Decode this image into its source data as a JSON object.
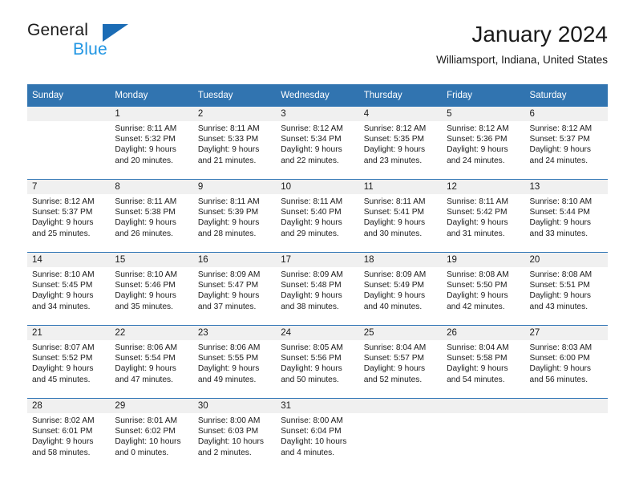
{
  "brand": {
    "name_top": "General",
    "name_bottom": "Blue",
    "triangle_icon": "triangle-icon",
    "accent_blue": "#1b6cb5",
    "light_blue": "#2196e3"
  },
  "header": {
    "title": "January 2024",
    "location": "Williamsport, Indiana, United States"
  },
  "theme": {
    "header_blue": "#3174b0",
    "row_rule_blue": "#2e74b5",
    "daynum_band": "#f0f0f0"
  },
  "columns": [
    "Sunday",
    "Monday",
    "Tuesday",
    "Wednesday",
    "Thursday",
    "Friday",
    "Saturday"
  ],
  "weeks": [
    [
      {
        "day": ""
      },
      {
        "day": "1",
        "sunrise": "Sunrise: 8:11 AM",
        "sunset": "Sunset: 5:32 PM",
        "daylight_1": "Daylight: 9 hours",
        "daylight_2": "and 20 minutes."
      },
      {
        "day": "2",
        "sunrise": "Sunrise: 8:11 AM",
        "sunset": "Sunset: 5:33 PM",
        "daylight_1": "Daylight: 9 hours",
        "daylight_2": "and 21 minutes."
      },
      {
        "day": "3",
        "sunrise": "Sunrise: 8:12 AM",
        "sunset": "Sunset: 5:34 PM",
        "daylight_1": "Daylight: 9 hours",
        "daylight_2": "and 22 minutes."
      },
      {
        "day": "4",
        "sunrise": "Sunrise: 8:12 AM",
        "sunset": "Sunset: 5:35 PM",
        "daylight_1": "Daylight: 9 hours",
        "daylight_2": "and 23 minutes."
      },
      {
        "day": "5",
        "sunrise": "Sunrise: 8:12 AM",
        "sunset": "Sunset: 5:36 PM",
        "daylight_1": "Daylight: 9 hours",
        "daylight_2": "and 24 minutes."
      },
      {
        "day": "6",
        "sunrise": "Sunrise: 8:12 AM",
        "sunset": "Sunset: 5:37 PM",
        "daylight_1": "Daylight: 9 hours",
        "daylight_2": "and 24 minutes."
      }
    ],
    [
      {
        "day": "7",
        "sunrise": "Sunrise: 8:12 AM",
        "sunset": "Sunset: 5:37 PM",
        "daylight_1": "Daylight: 9 hours",
        "daylight_2": "and 25 minutes."
      },
      {
        "day": "8",
        "sunrise": "Sunrise: 8:11 AM",
        "sunset": "Sunset: 5:38 PM",
        "daylight_1": "Daylight: 9 hours",
        "daylight_2": "and 26 minutes."
      },
      {
        "day": "9",
        "sunrise": "Sunrise: 8:11 AM",
        "sunset": "Sunset: 5:39 PM",
        "daylight_1": "Daylight: 9 hours",
        "daylight_2": "and 28 minutes."
      },
      {
        "day": "10",
        "sunrise": "Sunrise: 8:11 AM",
        "sunset": "Sunset: 5:40 PM",
        "daylight_1": "Daylight: 9 hours",
        "daylight_2": "and 29 minutes."
      },
      {
        "day": "11",
        "sunrise": "Sunrise: 8:11 AM",
        "sunset": "Sunset: 5:41 PM",
        "daylight_1": "Daylight: 9 hours",
        "daylight_2": "and 30 minutes."
      },
      {
        "day": "12",
        "sunrise": "Sunrise: 8:11 AM",
        "sunset": "Sunset: 5:42 PM",
        "daylight_1": "Daylight: 9 hours",
        "daylight_2": "and 31 minutes."
      },
      {
        "day": "13",
        "sunrise": "Sunrise: 8:10 AM",
        "sunset": "Sunset: 5:44 PM",
        "daylight_1": "Daylight: 9 hours",
        "daylight_2": "and 33 minutes."
      }
    ],
    [
      {
        "day": "14",
        "sunrise": "Sunrise: 8:10 AM",
        "sunset": "Sunset: 5:45 PM",
        "daylight_1": "Daylight: 9 hours",
        "daylight_2": "and 34 minutes."
      },
      {
        "day": "15",
        "sunrise": "Sunrise: 8:10 AM",
        "sunset": "Sunset: 5:46 PM",
        "daylight_1": "Daylight: 9 hours",
        "daylight_2": "and 35 minutes."
      },
      {
        "day": "16",
        "sunrise": "Sunrise: 8:09 AM",
        "sunset": "Sunset: 5:47 PM",
        "daylight_1": "Daylight: 9 hours",
        "daylight_2": "and 37 minutes."
      },
      {
        "day": "17",
        "sunrise": "Sunrise: 8:09 AM",
        "sunset": "Sunset: 5:48 PM",
        "daylight_1": "Daylight: 9 hours",
        "daylight_2": "and 38 minutes."
      },
      {
        "day": "18",
        "sunrise": "Sunrise: 8:09 AM",
        "sunset": "Sunset: 5:49 PM",
        "daylight_1": "Daylight: 9 hours",
        "daylight_2": "and 40 minutes."
      },
      {
        "day": "19",
        "sunrise": "Sunrise: 8:08 AM",
        "sunset": "Sunset: 5:50 PM",
        "daylight_1": "Daylight: 9 hours",
        "daylight_2": "and 42 minutes."
      },
      {
        "day": "20",
        "sunrise": "Sunrise: 8:08 AM",
        "sunset": "Sunset: 5:51 PM",
        "daylight_1": "Daylight: 9 hours",
        "daylight_2": "and 43 minutes."
      }
    ],
    [
      {
        "day": "21",
        "sunrise": "Sunrise: 8:07 AM",
        "sunset": "Sunset: 5:52 PM",
        "daylight_1": "Daylight: 9 hours",
        "daylight_2": "and 45 minutes."
      },
      {
        "day": "22",
        "sunrise": "Sunrise: 8:06 AM",
        "sunset": "Sunset: 5:54 PM",
        "daylight_1": "Daylight: 9 hours",
        "daylight_2": "and 47 minutes."
      },
      {
        "day": "23",
        "sunrise": "Sunrise: 8:06 AM",
        "sunset": "Sunset: 5:55 PM",
        "daylight_1": "Daylight: 9 hours",
        "daylight_2": "and 49 minutes."
      },
      {
        "day": "24",
        "sunrise": "Sunrise: 8:05 AM",
        "sunset": "Sunset: 5:56 PM",
        "daylight_1": "Daylight: 9 hours",
        "daylight_2": "and 50 minutes."
      },
      {
        "day": "25",
        "sunrise": "Sunrise: 8:04 AM",
        "sunset": "Sunset: 5:57 PM",
        "daylight_1": "Daylight: 9 hours",
        "daylight_2": "and 52 minutes."
      },
      {
        "day": "26",
        "sunrise": "Sunrise: 8:04 AM",
        "sunset": "Sunset: 5:58 PM",
        "daylight_1": "Daylight: 9 hours",
        "daylight_2": "and 54 minutes."
      },
      {
        "day": "27",
        "sunrise": "Sunrise: 8:03 AM",
        "sunset": "Sunset: 6:00 PM",
        "daylight_1": "Daylight: 9 hours",
        "daylight_2": "and 56 minutes."
      }
    ],
    [
      {
        "day": "28",
        "sunrise": "Sunrise: 8:02 AM",
        "sunset": "Sunset: 6:01 PM",
        "daylight_1": "Daylight: 9 hours",
        "daylight_2": "and 58 minutes."
      },
      {
        "day": "29",
        "sunrise": "Sunrise: 8:01 AM",
        "sunset": "Sunset: 6:02 PM",
        "daylight_1": "Daylight: 10 hours",
        "daylight_2": "and 0 minutes."
      },
      {
        "day": "30",
        "sunrise": "Sunrise: 8:00 AM",
        "sunset": "Sunset: 6:03 PM",
        "daylight_1": "Daylight: 10 hours",
        "daylight_2": "and 2 minutes."
      },
      {
        "day": "31",
        "sunrise": "Sunrise: 8:00 AM",
        "sunset": "Sunset: 6:04 PM",
        "daylight_1": "Daylight: 10 hours",
        "daylight_2": "and 4 minutes."
      },
      {
        "day": ""
      },
      {
        "day": ""
      },
      {
        "day": ""
      }
    ]
  ]
}
